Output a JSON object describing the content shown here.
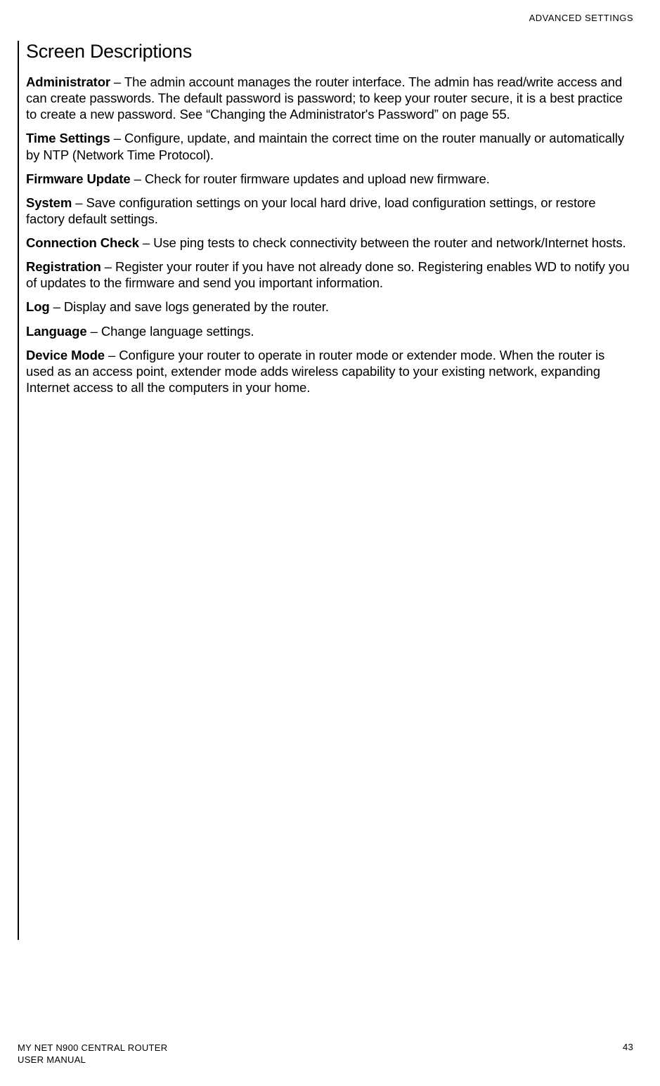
{
  "header": {
    "section_label": "ADVANCED SETTINGS"
  },
  "content": {
    "heading": "Screen Descriptions",
    "items": [
      {
        "term": "Administrator",
        "desc": " – The admin account manages the router interface. The admin has read/write access and can create passwords. The default password is password; to keep your router secure, it is a best practice to create a new password. See “Changing the Administrator's Password” on page 55."
      },
      {
        "term": "Time Settings",
        "desc": " – Configure, update, and maintain the correct time on the router manually or automatically by NTP (Network Time Protocol)."
      },
      {
        "term": "Firmware Update",
        "desc": " – Check for router firmware updates and upload new firmware."
      },
      {
        "term": "System",
        "desc": " – Save configuration settings on your local hard drive, load configuration settings, or restore factory default settings."
      },
      {
        "term": "Connection Check",
        "desc": " – Use ping tests to check connectivity between the router and network/Internet hosts."
      },
      {
        "term": "Registration",
        "desc": " – Register your router if you have not already done so. Registering enables WD to notify you of updates to the firmware and send you important information."
      },
      {
        "term": "Log",
        "desc": " – Display and save logs generated by the router."
      },
      {
        "term": "Language",
        "desc": " – Change language settings."
      },
      {
        "term": "Device Mode",
        "desc": " – Configure your router to operate in router mode or extender mode. When the router is used as an access point, extender mode adds wireless capability to your existing network, expanding Internet access to all the computers in your home."
      }
    ]
  },
  "footer": {
    "product_line1": "MY NET N900 CENTRAL ROUTER",
    "product_line2": "USER MANUAL",
    "page_number": "43"
  }
}
